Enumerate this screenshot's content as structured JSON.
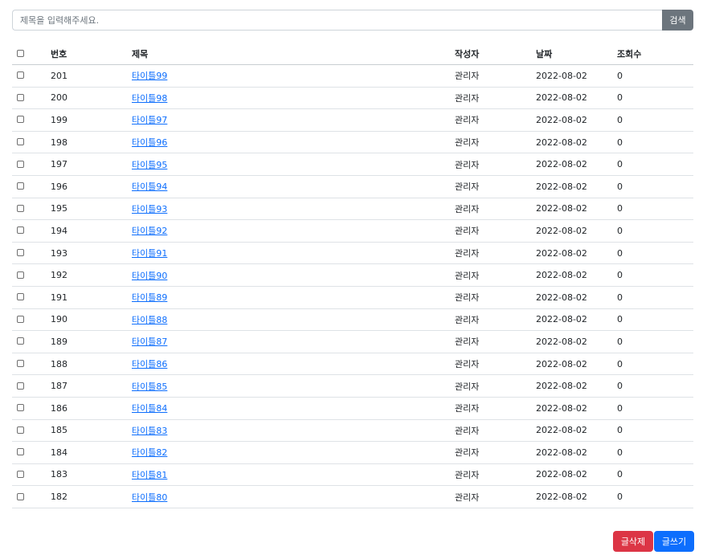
{
  "search": {
    "placeholder": "제목을 입력해주세요.",
    "button_label": "검색"
  },
  "table": {
    "headers": {
      "number": "번호",
      "title": "제목",
      "writer": "작성자",
      "date": "날짜",
      "views": "조회수"
    },
    "rows": [
      {
        "number": "201",
        "title": "타이틀99",
        "writer": "관리자",
        "date": "2022-08-02",
        "views": "0"
      },
      {
        "number": "200",
        "title": "타이틀98",
        "writer": "관리자",
        "date": "2022-08-02",
        "views": "0"
      },
      {
        "number": "199",
        "title": "타이틀97",
        "writer": "관리자",
        "date": "2022-08-02",
        "views": "0"
      },
      {
        "number": "198",
        "title": "타이틀96",
        "writer": "관리자",
        "date": "2022-08-02",
        "views": "0"
      },
      {
        "number": "197",
        "title": "타이틀95",
        "writer": "관리자",
        "date": "2022-08-02",
        "views": "0"
      },
      {
        "number": "196",
        "title": "타이틀94",
        "writer": "관리자",
        "date": "2022-08-02",
        "views": "0"
      },
      {
        "number": "195",
        "title": "타이틀93",
        "writer": "관리자",
        "date": "2022-08-02",
        "views": "0"
      },
      {
        "number": "194",
        "title": "타이틀92",
        "writer": "관리자",
        "date": "2022-08-02",
        "views": "0"
      },
      {
        "number": "193",
        "title": "타이틀91",
        "writer": "관리자",
        "date": "2022-08-02",
        "views": "0"
      },
      {
        "number": "192",
        "title": "타이틀90",
        "writer": "관리자",
        "date": "2022-08-02",
        "views": "0"
      },
      {
        "number": "191",
        "title": "타이틀89",
        "writer": "관리자",
        "date": "2022-08-02",
        "views": "0"
      },
      {
        "number": "190",
        "title": "타이틀88",
        "writer": "관리자",
        "date": "2022-08-02",
        "views": "0"
      },
      {
        "number": "189",
        "title": "타이틀87",
        "writer": "관리자",
        "date": "2022-08-02",
        "views": "0"
      },
      {
        "number": "188",
        "title": "타이틀86",
        "writer": "관리자",
        "date": "2022-08-02",
        "views": "0"
      },
      {
        "number": "187",
        "title": "타이틀85",
        "writer": "관리자",
        "date": "2022-08-02",
        "views": "0"
      },
      {
        "number": "186",
        "title": "타이틀84",
        "writer": "관리자",
        "date": "2022-08-02",
        "views": "0"
      },
      {
        "number": "185",
        "title": "타이틀83",
        "writer": "관리자",
        "date": "2022-08-02",
        "views": "0"
      },
      {
        "number": "184",
        "title": "타이틀82",
        "writer": "관리자",
        "date": "2022-08-02",
        "views": "0"
      },
      {
        "number": "183",
        "title": "타이틀81",
        "writer": "관리자",
        "date": "2022-08-02",
        "views": "0"
      },
      {
        "number": "182",
        "title": "타이틀80",
        "writer": "관리자",
        "date": "2022-08-02",
        "views": "0"
      }
    ]
  },
  "actions": {
    "delete_label": "글삭제",
    "write_label": "글쓰기"
  },
  "colors": {
    "search_button": "#6c757d",
    "link": "#0d6efd",
    "delete_button": "#dc3545",
    "write_button": "#0d6efd"
  }
}
